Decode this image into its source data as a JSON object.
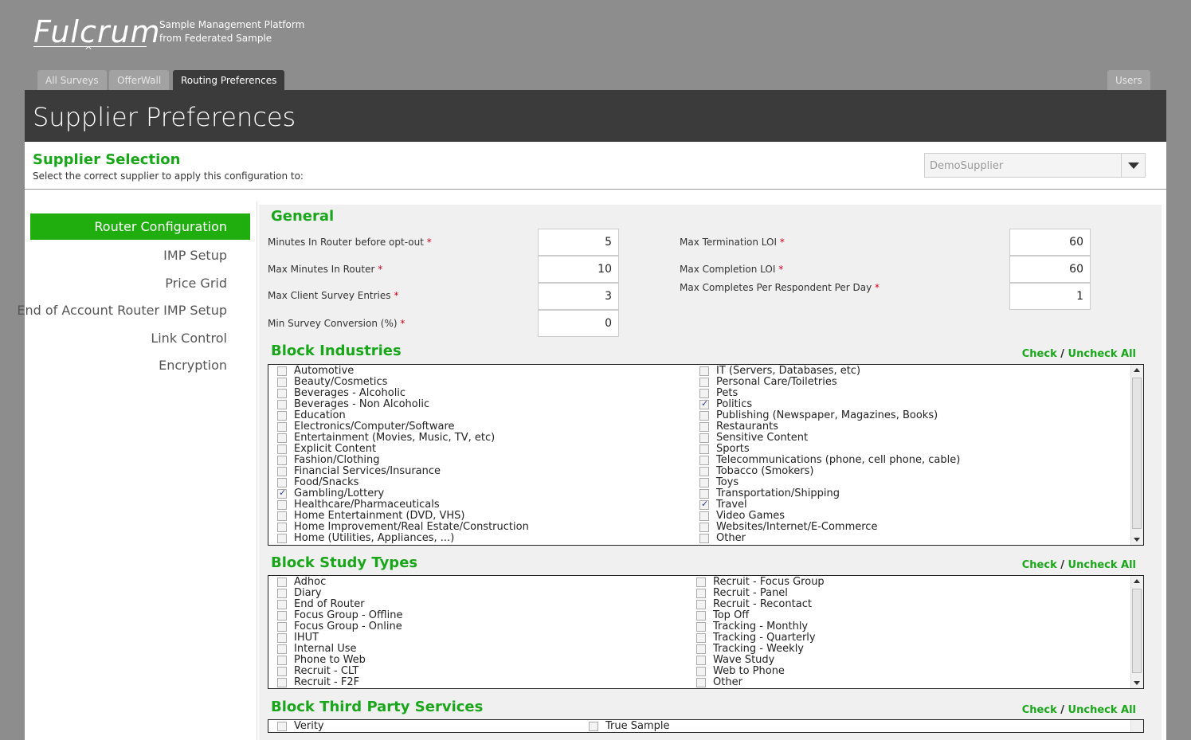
{
  "brand": {
    "logo": "Fulcrum",
    "tagline_line1": "Sample Management Platform",
    "tagline_line2": "from Federated Sample"
  },
  "tabs": [
    {
      "label": "All Surveys",
      "active": false
    },
    {
      "label": "OfferWall",
      "active": false
    },
    {
      "label": "Routing Preferences",
      "active": true
    },
    {
      "label": "Users",
      "active": false
    }
  ],
  "page_title": "Supplier Preferences",
  "supplier_selection": {
    "title": "Supplier Selection",
    "subtitle": "Select the correct supplier to apply this configuration to:",
    "selected": "DemoSupplier"
  },
  "sidebar": {
    "items": [
      "Router Configuration",
      "IMP Setup",
      "Price Grid",
      "End of Account Router IMP Setup",
      "Link Control",
      "Encryption"
    ],
    "active_index": 0
  },
  "general": {
    "title": "General",
    "left_fields": [
      {
        "label": "Minutes In Router before opt-out",
        "value": "5"
      },
      {
        "label": "Max Minutes In Router",
        "value": "10"
      },
      {
        "label": "Max Client Survey Entries",
        "value": "3"
      },
      {
        "label": "Min Survey Conversion (%)",
        "value": "0"
      }
    ],
    "right_fields": [
      {
        "label": "Max Termination LOI",
        "value": "60"
      },
      {
        "label": "Max Completion LOI",
        "value": "60"
      },
      {
        "label": "Max Completes Per Respondent Per Day",
        "value": "1"
      }
    ],
    "required_mark": "*"
  },
  "check_all": {
    "check": "Check",
    "slash": "/",
    "uncheck": "Uncheck All"
  },
  "block_industries": {
    "title": "Block Industries",
    "left": [
      {
        "label": "Automotive",
        "checked": false
      },
      {
        "label": "Beauty/Cosmetics",
        "checked": false
      },
      {
        "label": "Beverages - Alcoholic",
        "checked": false
      },
      {
        "label": "Beverages - Non Alcoholic",
        "checked": false
      },
      {
        "label": "Education",
        "checked": false
      },
      {
        "label": "Electronics/Computer/Software",
        "checked": false
      },
      {
        "label": "Entertainment (Movies, Music, TV, etc)",
        "checked": false
      },
      {
        "label": "Explicit Content",
        "checked": false
      },
      {
        "label": "Fashion/Clothing",
        "checked": false
      },
      {
        "label": "Financial Services/Insurance",
        "checked": false
      },
      {
        "label": "Food/Snacks",
        "checked": false
      },
      {
        "label": "Gambling/Lottery",
        "checked": true
      },
      {
        "label": "Healthcare/Pharmaceuticals",
        "checked": false
      },
      {
        "label": "Home Entertainment (DVD, VHS)",
        "checked": false
      },
      {
        "label": "Home Improvement/Real Estate/Construction",
        "checked": false
      },
      {
        "label": "Home (Utilities, Appliances, ...)",
        "checked": false
      }
    ],
    "right": [
      {
        "label": "IT (Servers, Databases, etc)",
        "checked": false
      },
      {
        "label": "Personal Care/Toiletries",
        "checked": false
      },
      {
        "label": "Pets",
        "checked": false
      },
      {
        "label": "Politics",
        "checked": true
      },
      {
        "label": "Publishing (Newspaper, Magazines, Books)",
        "checked": false
      },
      {
        "label": "Restaurants",
        "checked": false
      },
      {
        "label": "Sensitive Content",
        "checked": false
      },
      {
        "label": "Sports",
        "checked": false
      },
      {
        "label": "Telecommunications (phone, cell phone, cable)",
        "checked": false
      },
      {
        "label": "Tobacco (Smokers)",
        "checked": false
      },
      {
        "label": "Toys",
        "checked": false
      },
      {
        "label": "Transportation/Shipping",
        "checked": false
      },
      {
        "label": "Travel",
        "checked": true
      },
      {
        "label": "Video Games",
        "checked": false
      },
      {
        "label": "Websites/Internet/E-Commerce",
        "checked": false
      },
      {
        "label": "Other",
        "checked": false
      }
    ]
  },
  "block_study_types": {
    "title": "Block Study Types",
    "left": [
      {
        "label": "Adhoc",
        "checked": false
      },
      {
        "label": "Diary",
        "checked": false
      },
      {
        "label": "End of Router",
        "checked": false
      },
      {
        "label": "Focus Group - Offline",
        "checked": false
      },
      {
        "label": "Focus Group - Online",
        "checked": false
      },
      {
        "label": "IHUT",
        "checked": false
      },
      {
        "label": "Internal Use",
        "checked": false
      },
      {
        "label": "Phone to Web",
        "checked": false
      },
      {
        "label": "Recruit - CLT",
        "checked": false
      },
      {
        "label": "Recruit - F2F",
        "checked": false
      }
    ],
    "right": [
      {
        "label": "Recruit - Focus Group",
        "checked": false
      },
      {
        "label": "Recruit - Panel",
        "checked": false
      },
      {
        "label": "Recruit - Recontact",
        "checked": false
      },
      {
        "label": "Top Off",
        "checked": false
      },
      {
        "label": "Tracking - Monthly",
        "checked": false
      },
      {
        "label": "Tracking - Quarterly",
        "checked": false
      },
      {
        "label": "Tracking - Weekly",
        "checked": false
      },
      {
        "label": "Wave Study",
        "checked": false
      },
      {
        "label": "Web to Phone",
        "checked": false
      },
      {
        "label": "Other",
        "checked": false
      }
    ]
  },
  "block_third_party": {
    "title": "Block Third Party Services",
    "items": [
      {
        "label": "Verity",
        "checked": false
      },
      {
        "label": "True Sample",
        "checked": false
      }
    ]
  }
}
